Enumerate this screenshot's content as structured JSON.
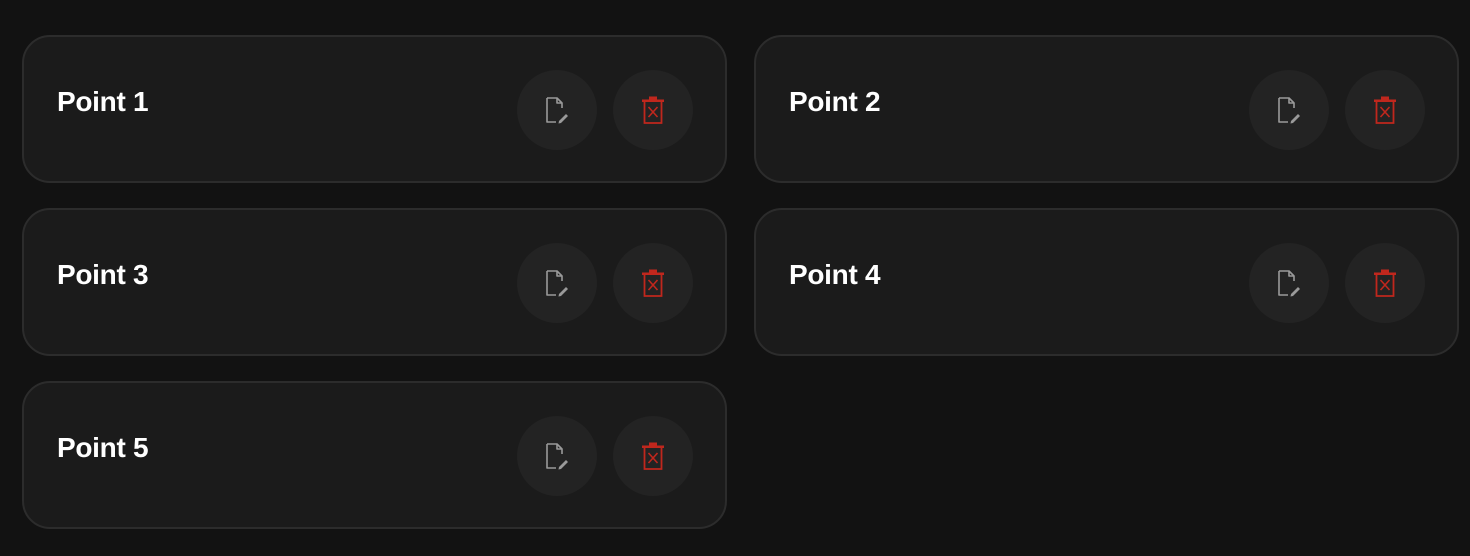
{
  "colors": {
    "background": "#121212",
    "card": "#1b1b1b",
    "card_border": "#2c2c2c",
    "button": "#232323",
    "edit_icon": "#9a9a9a",
    "delete_icon": "#c0271d",
    "title": "#ffffff"
  },
  "icons": {
    "edit": "file-edit-icon",
    "delete": "trash-x-icon"
  },
  "points": [
    {
      "title": "Point 1"
    },
    {
      "title": "Point 2"
    },
    {
      "title": "Point 3"
    },
    {
      "title": "Point 4"
    },
    {
      "title": "Point 5"
    }
  ]
}
